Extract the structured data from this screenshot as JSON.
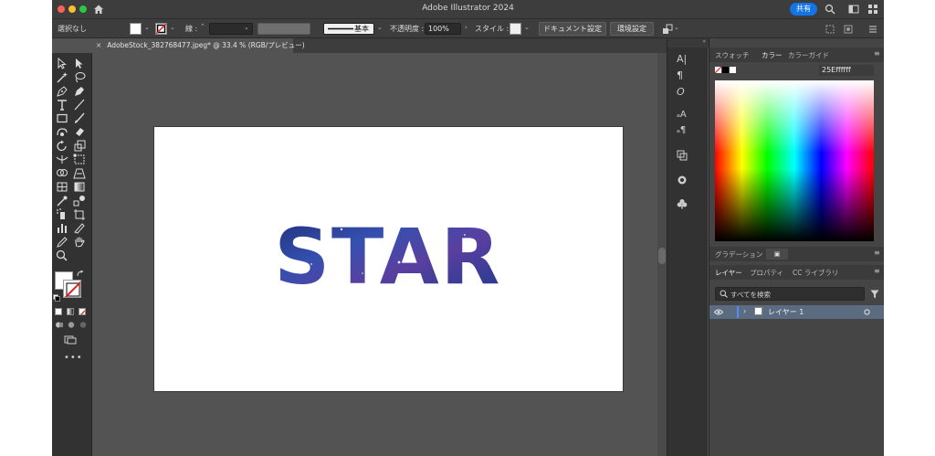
{
  "window": {
    "title": "Adobe Illustrator 2024",
    "share_label": "共有"
  },
  "control_bar": {
    "selection": "選択なし",
    "stroke_label": "線 :",
    "stroke_style": "基本",
    "opacity_label": "不透明度 :",
    "opacity_value": "100%",
    "style_label": "スタイル :",
    "doc_settings": "ドキュメント設定",
    "prefs": "環境設定"
  },
  "document": {
    "tab_title": "AdobeStock_382768477.jpeg* @ 33.4 % (RGB/プレビュー)",
    "close_glyph": "×",
    "artwork_text": "STAR"
  },
  "panels": {
    "top_tabs": [
      "スウォッチ",
      "カラー",
      "カラーガイド"
    ],
    "hex_prefix": "25E",
    "hex_value": "ffffff",
    "gradient_tab": "グラデーション",
    "layer_tabs": [
      "レイヤー",
      "プロパティ",
      "CC ライブラリ"
    ],
    "search_placeholder": "すべてを検索",
    "layer_name": "レイヤー 1"
  },
  "colors": {
    "accent": "#1473e6",
    "artwork_fill": "#2a3f8f",
    "layer_highlight": "#5b6b80"
  },
  "icons": {
    "toolbar": [
      "home-icon",
      "search-icon",
      "workspace-icon",
      "panels-icon"
    ],
    "tools": [
      "selection-tool-icon",
      "direct-selection-tool-icon",
      "magic-wand-icon",
      "lasso-icon",
      "pen-tool-icon",
      "curvature-tool-icon",
      "type-tool-icon",
      "line-tool-icon",
      "rectangle-tool-icon",
      "paintbrush-icon",
      "shaper-tool-icon",
      "eraser-icon",
      "rotate-tool-icon",
      "scale-tool-icon",
      "width-tool-icon",
      "free-transform-icon",
      "shape-builder-icon",
      "perspective-grid-icon",
      "mesh-tool-icon",
      "gradient-tool-icon",
      "eyedropper-icon",
      "blend-tool-icon",
      "symbol-sprayer-icon",
      "artboard-tool-icon",
      "graph-tool-icon",
      "slice-tool-icon",
      "hand-tool-icon",
      "zoom-tool-icon"
    ]
  }
}
